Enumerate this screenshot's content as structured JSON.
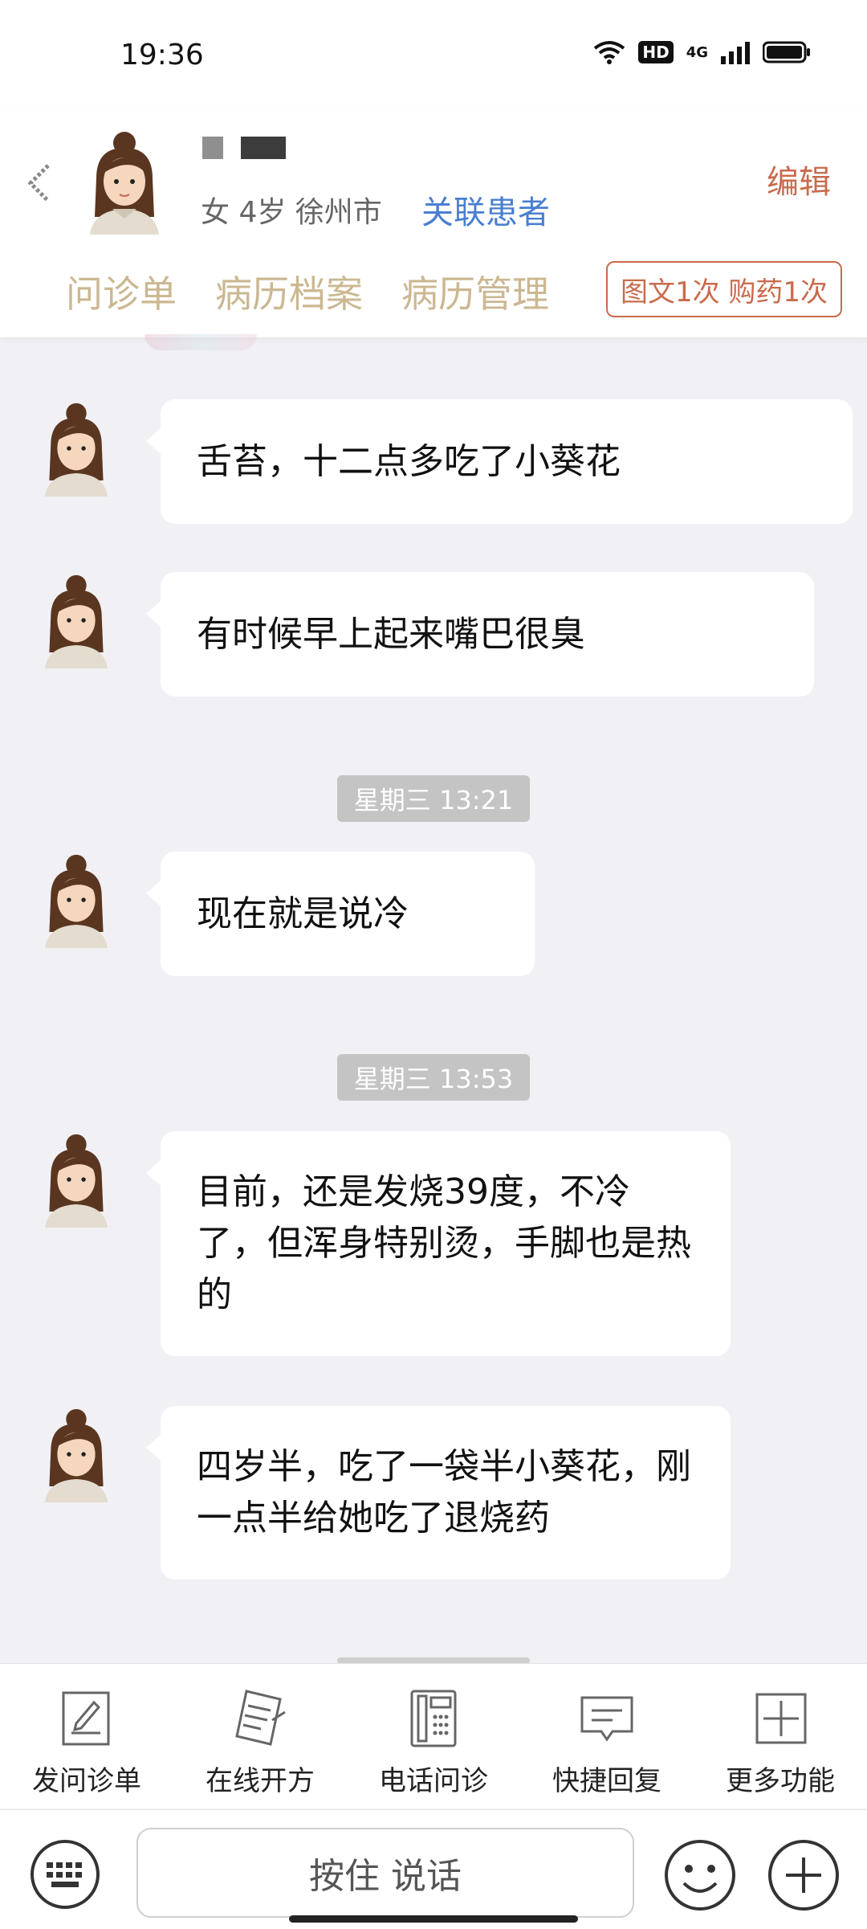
{
  "status_bar": {
    "time": "19:36",
    "hd": "HD",
    "network": "4G"
  },
  "header": {
    "patient_info": "女 4岁  徐州市",
    "link_patient": "关联患者",
    "edit": "编辑",
    "tabs": [
      {
        "label": "问诊单"
      },
      {
        "label": "病历档案"
      },
      {
        "label": "病历管理"
      }
    ],
    "service_badge": "图文1次 购药1次"
  },
  "messages": [
    {
      "text": "舌苔，十二点多吃了小葵花"
    },
    {
      "text": "有时候早上起来嘴巴很臭"
    },
    {
      "timestamp": "星期三 13:21"
    },
    {
      "text": "现在就是说冷"
    },
    {
      "timestamp": "星期三 13:53"
    },
    {
      "text": "目前，还是发烧39度，不冷了，但浑身特别烫，手脚也是热的"
    },
    {
      "text": "四岁半，吃了一袋半小葵花，刚一点半给她吃了退烧药"
    }
  ],
  "toolbar": {
    "items": [
      {
        "label": "发问诊单",
        "icon": "form-icon"
      },
      {
        "label": "在线开方",
        "icon": "prescription-icon"
      },
      {
        "label": "电话问诊",
        "icon": "phone-icon"
      },
      {
        "label": "快捷回复",
        "icon": "quick-reply-icon"
      },
      {
        "label": "更多功能",
        "icon": "plus-square-icon"
      }
    ]
  },
  "input_bar": {
    "hold_to_talk": "按住 说话"
  }
}
